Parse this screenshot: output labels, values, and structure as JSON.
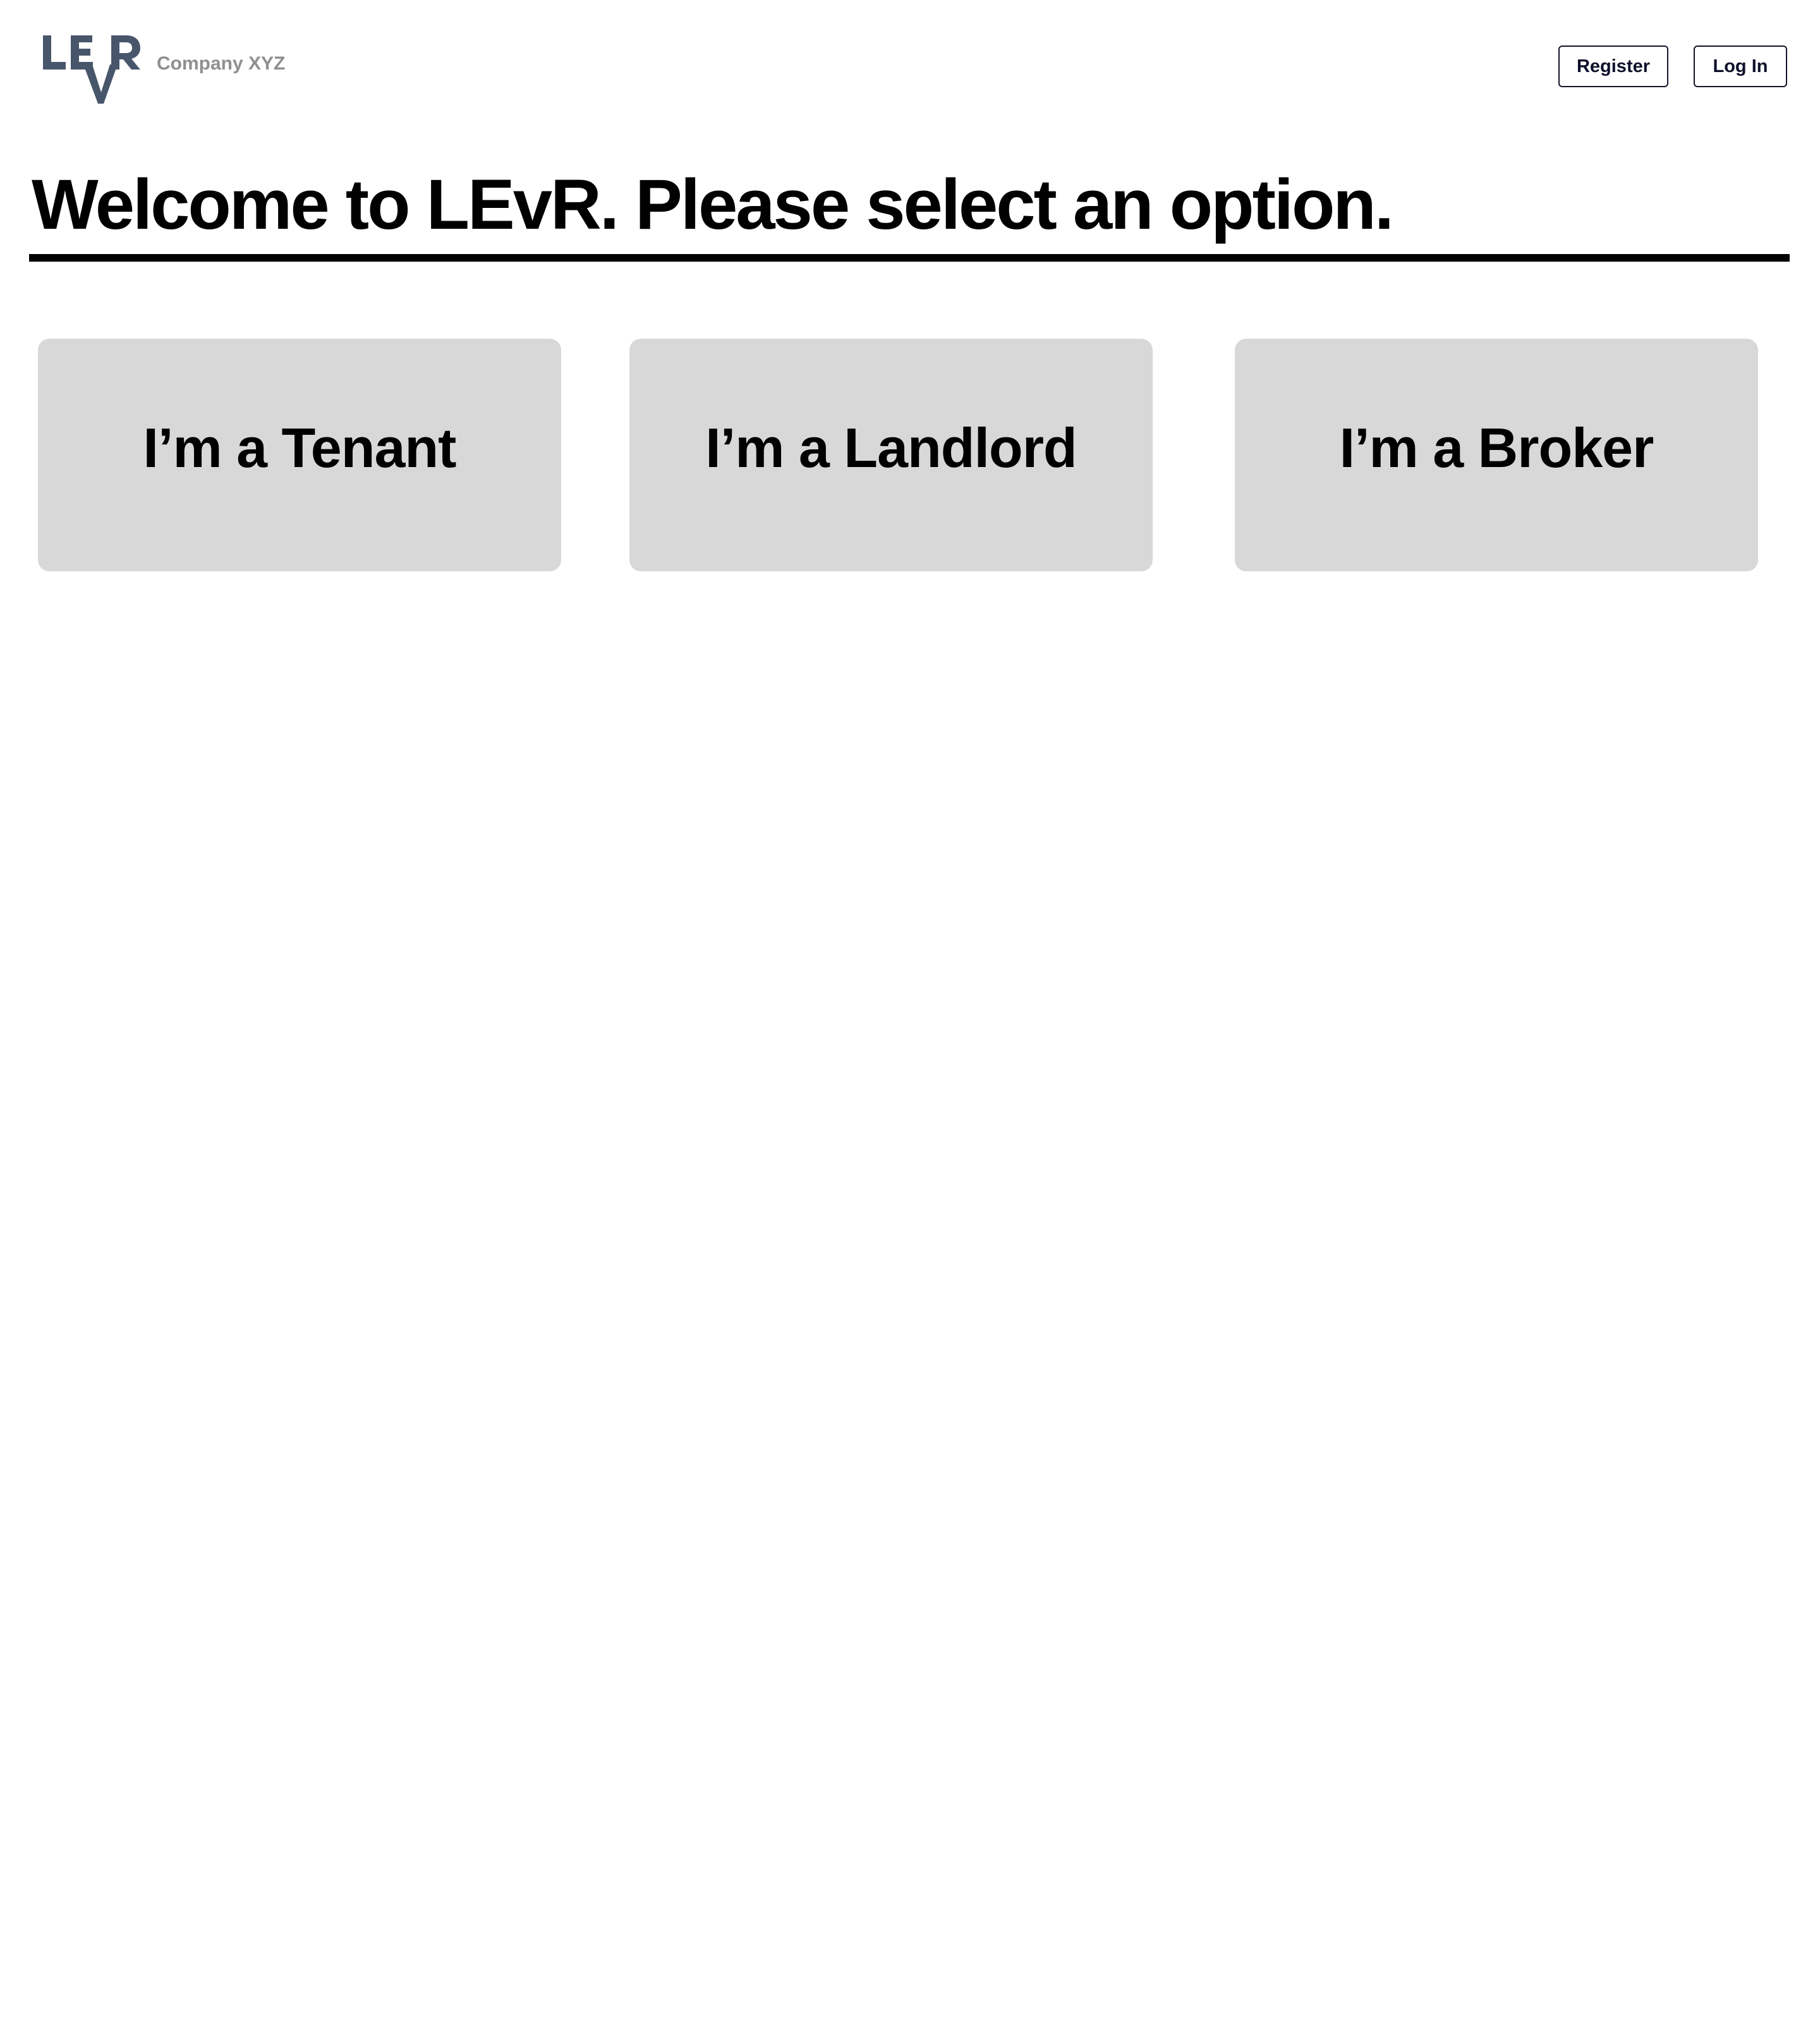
{
  "header": {
    "logo_text": "LEVR",
    "company_name": "Company XYZ",
    "register_label": "Register",
    "login_label": "Log In"
  },
  "main": {
    "title": "Welcome to LEvR. Please select an option.",
    "options": [
      {
        "label": "I’m a Tenant"
      },
      {
        "label": "I’m a Landlord"
      },
      {
        "label": "I’m a Broker"
      }
    ]
  },
  "colors": {
    "logo": "#48566b",
    "company_name": "#8f8f8f",
    "card_background": "#d8d8d8",
    "button_border": "#14142b",
    "rule": "#000000"
  }
}
